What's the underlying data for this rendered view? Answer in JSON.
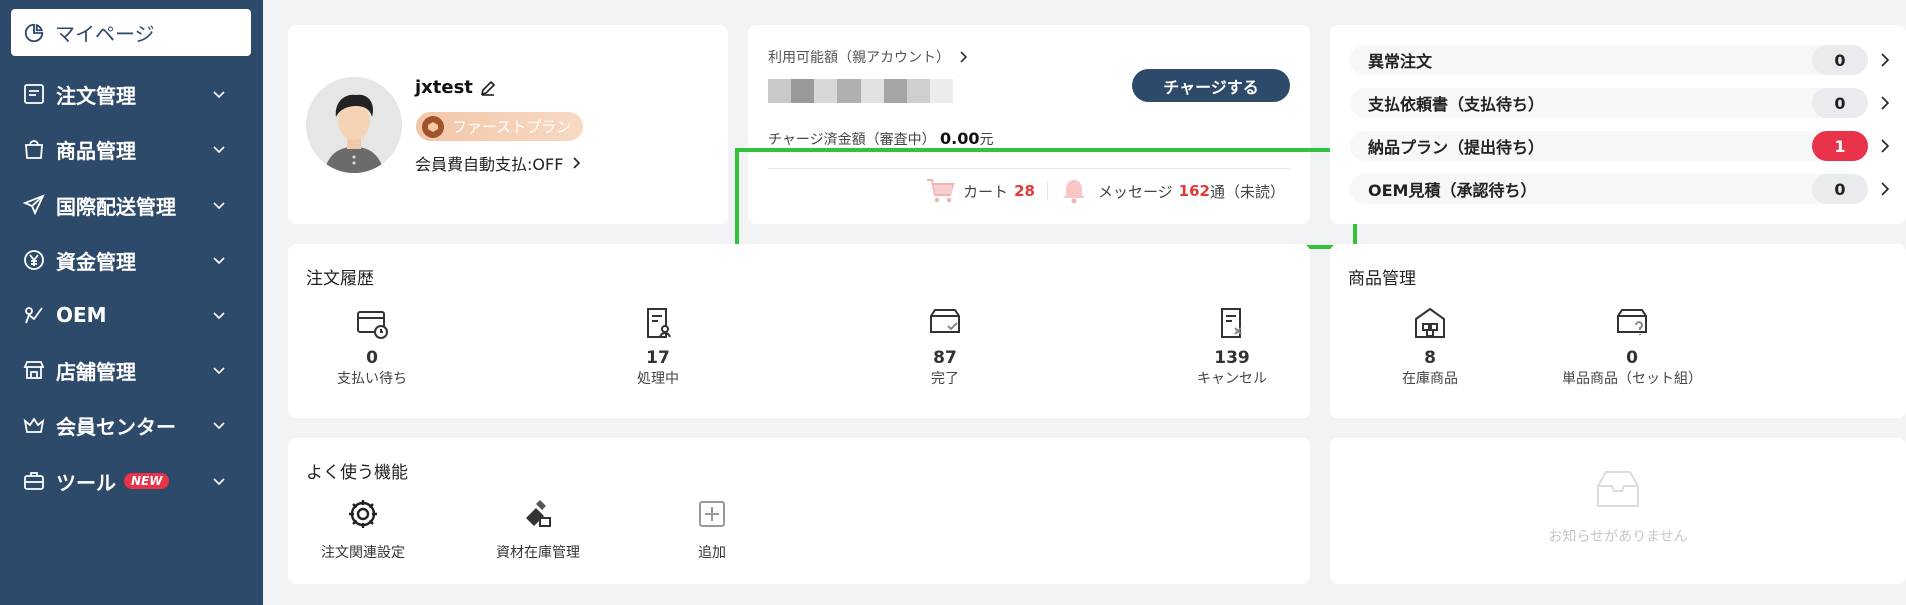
{
  "sidebar": {
    "active": {
      "label": "マイページ",
      "icon": "pie-chart-icon"
    },
    "items": [
      {
        "label": "注文管理",
        "icon": "order-list-icon"
      },
      {
        "label": "商品管理",
        "icon": "bag-icon"
      },
      {
        "label": "国際配送管理",
        "icon": "send-icon"
      },
      {
        "label": "資金管理",
        "icon": "yen-icon"
      },
      {
        "label": "OEM",
        "icon": "oem-icon"
      },
      {
        "label": "店舗管理",
        "icon": "store-icon"
      },
      {
        "label": "会員センター",
        "icon": "crown-icon"
      },
      {
        "label": "ツール",
        "icon": "toolbox-icon",
        "badge": "NEW"
      }
    ]
  },
  "profile": {
    "username": "jxtest",
    "plan": "ファーストプラン",
    "autopay": "会員費自動支払:OFF"
  },
  "balance": {
    "label": "利用可能額（親アカウント）",
    "charge_button": "チャージする",
    "pending_label": "チャージ済金額（審査中）",
    "pending_amount": "0.00",
    "pending_unit": "元",
    "cart_label": "カート",
    "cart_count": "28",
    "message_label": "メッセージ",
    "message_count": "162",
    "message_suffix": "通（未読）"
  },
  "status": [
    {
      "label": "異常注文",
      "count": "0"
    },
    {
      "label": "支払依頼書（支払待ち）",
      "count": "0"
    },
    {
      "label": "納品プラン（提出待ち）",
      "count": "1",
      "alert": true
    },
    {
      "label": "OEM見積（承認待ち）",
      "count": "0"
    }
  ],
  "orders": {
    "title": "注文履歴",
    "stats": [
      {
        "num": "0",
        "label": "支払い待ち",
        "icon": "card-clock-icon"
      },
      {
        "num": "17",
        "label": "処理中",
        "icon": "doc-person-icon"
      },
      {
        "num": "87",
        "label": "完了",
        "icon": "box-check-icon"
      },
      {
        "num": "139",
        "label": "キャンセル",
        "icon": "doc-cancel-icon"
      }
    ]
  },
  "products": {
    "title": "商品管理",
    "stats": [
      {
        "num": "8",
        "label": "在庫商品",
        "icon": "warehouse-icon"
      },
      {
        "num": "0",
        "label": "単品商品（セット組）",
        "icon": "box-question-icon"
      }
    ]
  },
  "functions": {
    "title": "よく使う機能",
    "items": [
      {
        "label": "注文関連設定",
        "icon": "gear-icon"
      },
      {
        "label": "資材在庫管理",
        "icon": "materials-icon"
      },
      {
        "label": "追加",
        "icon": "plus-square-icon"
      }
    ]
  },
  "notice": {
    "empty_text": "お知らせがありません",
    "icon": "empty-inbox-icon"
  }
}
